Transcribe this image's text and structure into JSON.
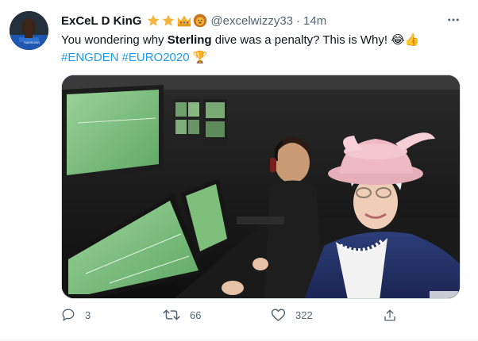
{
  "tweet": {
    "display_name": "ExCeL D KinG",
    "badges_icons": [
      "star-icon",
      "star-icon",
      "crown-icon",
      "lion-icon"
    ],
    "handle": "@excelwizzy33",
    "separator": "·",
    "time": "14m",
    "text": {
      "part1": "You wondering why ",
      "bold": "Sterling",
      "part2": " dive was a penalty? This is Why! ",
      "emoji": "😂👍"
    },
    "hashtags": [
      "#ENGDEN",
      "#EURO2020"
    ],
    "tag_emoji": "🏆"
  },
  "actions": {
    "reply_count": "3",
    "retweet_count": "66",
    "like_count": "322"
  },
  "colors": {
    "link": "#1d9bf0",
    "muted": "#536471",
    "star": "#f5b43f"
  }
}
